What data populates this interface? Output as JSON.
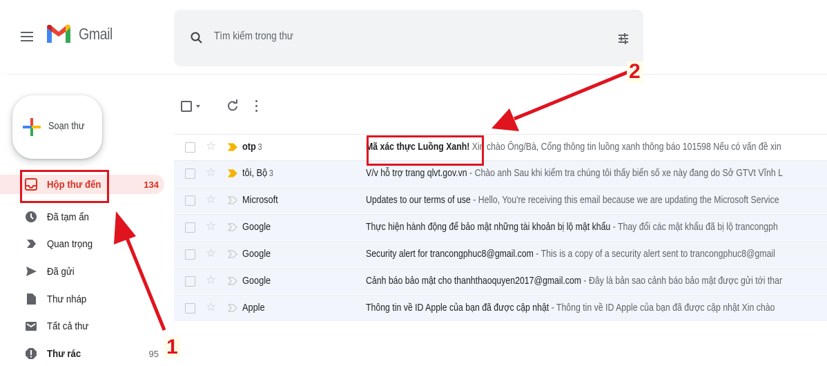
{
  "header": {
    "app_name": "Gmail",
    "search_placeholder": "Tìm kiếm trong thư"
  },
  "compose": {
    "label": "Soạn thư"
  },
  "sidebar": {
    "items": [
      {
        "label": "Hộp thư đến",
        "count": "134",
        "icon": "inbox-icon",
        "active": true
      },
      {
        "label": "Đã tạm ẩn",
        "count": "",
        "icon": "clock-icon"
      },
      {
        "label": "Quan trọng",
        "count": "",
        "icon": "important-icon"
      },
      {
        "label": "Đã gửi",
        "count": "",
        "icon": "send-icon"
      },
      {
        "label": "Thư nháp",
        "count": "",
        "icon": "draft-icon"
      },
      {
        "label": "Tất cả thư",
        "count": "",
        "icon": "all-mail-icon"
      },
      {
        "label": "Thư rác",
        "count": "95",
        "icon": "spam-icon",
        "bold": true
      }
    ]
  },
  "emails": [
    {
      "sender": "otp",
      "thread_count": "3",
      "subject": "Mã xác thực Luồng Xanh!",
      "separator": " ",
      "snippet": "Xin chào Ông/Bà, Cổng thông tin luồng xanh thông báo 101598 Nếu có vấn đề xin",
      "unread": true,
      "important": true
    },
    {
      "sender": "tôi, Bộ",
      "thread_count": "3",
      "subject": "V/v hỗ trợ trang qlvt.gov.vn",
      "separator": " - ",
      "snippet": "Chào anh Sau khi kiểm tra chúng tôi thấy biển số xe này đang do Sở GTVt Vĩnh L",
      "unread": false,
      "important": true
    },
    {
      "sender": "Microsoft",
      "thread_count": "",
      "subject": "Updates to our terms of use",
      "separator": " - ",
      "snippet": "Hello, You're receiving this email because we are updating the Microsoft Service",
      "unread": false,
      "important": false
    },
    {
      "sender": "Google",
      "thread_count": "",
      "subject": "Thực hiện hành động để bảo mật những tài khoản bị lộ mật khẩu",
      "separator": " - ",
      "snippet": "Thay đổi các mật khẩu đã bị lộ trancongph",
      "unread": false,
      "important": false
    },
    {
      "sender": "Google",
      "thread_count": "",
      "subject": "Security alert for trancongphuc8@gmail.com",
      "separator": " - ",
      "snippet": "This is a copy of a security alert sent to trancongphuc8@gmail",
      "unread": false,
      "important": false
    },
    {
      "sender": "Google",
      "thread_count": "",
      "subject": "Cảnh báo bảo mật cho thanhthaoquyen2017@gmail.com",
      "separator": " - ",
      "snippet": "Đây là bản sao cảnh báo bảo mật được gửi tới thar",
      "unread": false,
      "important": false
    },
    {
      "sender": "Apple",
      "thread_count": "",
      "subject": "Thông tin về ID Apple của bạn đã được cập nhật",
      "separator": " - ",
      "snippet": "Thông tin về ID Apple của bạn đã được cập nhật Xin chào",
      "unread": false,
      "important": false
    }
  ],
  "annotations": {
    "label_1": "1",
    "label_2": "2",
    "color": "#e0141e"
  },
  "colors": {
    "accent_red": "#d93025",
    "active_bg": "#fce8e6",
    "important_yellow": "#f4b400"
  }
}
